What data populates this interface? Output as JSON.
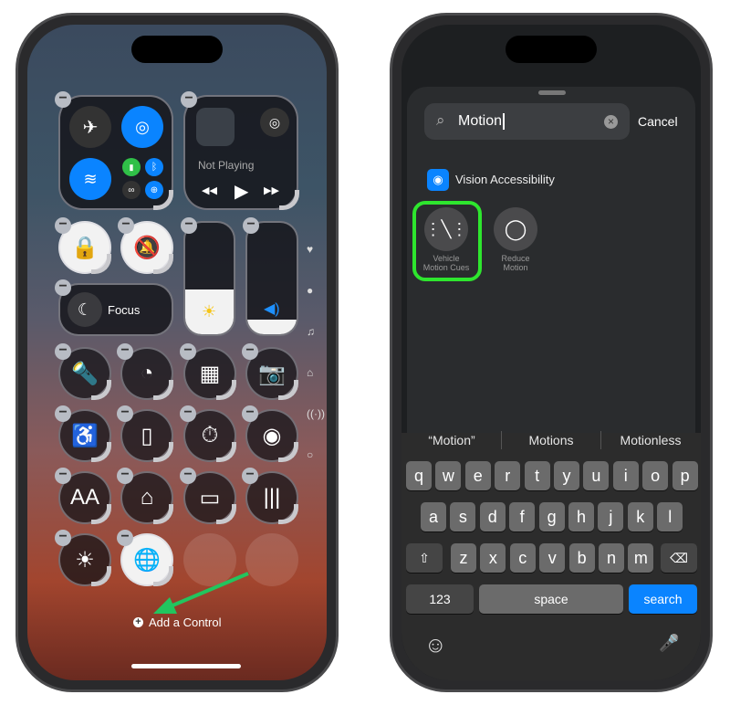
{
  "left": {
    "connectivity": {
      "airplane": "airplane-icon",
      "airdrop": "airdrop-icon",
      "wifi": "wifi-icon",
      "cellular": "cellular-icon",
      "bluetooth": "bluetooth-icon",
      "link": "link-icon",
      "satellite": "satellite-icon"
    },
    "media": {
      "status": "Not Playing",
      "rewind": "◀◀",
      "play": "▶",
      "forward": "▶▶"
    },
    "focus_label": "Focus",
    "brightness_level": 0.4,
    "volume_level": 0.13,
    "controls": [
      {
        "name": "flashlight",
        "glyph": "🔦"
      },
      {
        "name": "timer",
        "glyph": "◔"
      },
      {
        "name": "calculator",
        "glyph": "▦"
      },
      {
        "name": "camera",
        "glyph": "📷"
      },
      {
        "name": "accessibility",
        "glyph": "♿"
      },
      {
        "name": "remote",
        "glyph": "▯"
      },
      {
        "name": "stopwatch",
        "glyph": "⏱"
      },
      {
        "name": "screen-record",
        "glyph": "◉"
      },
      {
        "name": "text-size",
        "glyph": "AA"
      },
      {
        "name": "home",
        "glyph": "⌂"
      },
      {
        "name": "low-power",
        "glyph": "▭"
      },
      {
        "name": "sound-recognition",
        "glyph": "|||"
      },
      {
        "name": "dark-mode",
        "glyph": "☀"
      },
      {
        "name": "satellite",
        "glyph": "🌐"
      },
      {
        "name": "empty",
        "glyph": ""
      },
      {
        "name": "empty",
        "glyph": ""
      }
    ],
    "add_control_label": "Add a Control",
    "side_icons": [
      "♥",
      "●",
      "♫",
      "⌂",
      "((·))",
      "○"
    ],
    "arrow_color": "#22c55e"
  },
  "right": {
    "search": {
      "value": "Motion",
      "clear": "×",
      "cancel": "Cancel"
    },
    "section_title": "Vision Accessibility",
    "results": [
      {
        "label_line1": "Vehicle",
        "label_line2": "Motion Cues",
        "highlight": true
      },
      {
        "label_line1": "Reduce",
        "label_line2": "Motion",
        "highlight": false
      }
    ],
    "highlight_color": "#2ee62e",
    "suggestions": [
      "“Motion”",
      "Motions",
      "Motionless"
    ],
    "keyboard": {
      "rows": [
        [
          "q",
          "w",
          "e",
          "r",
          "t",
          "y",
          "u",
          "i",
          "o",
          "p"
        ],
        [
          "a",
          "s",
          "d",
          "f",
          "g",
          "h",
          "j",
          "k",
          "l"
        ],
        [
          "z",
          "x",
          "c",
          "v",
          "b",
          "n",
          "m"
        ]
      ],
      "shift": "⇧",
      "delete": "⌫",
      "numbers": "123",
      "space": "space",
      "search": "search",
      "emoji": "☺",
      "mic": "🎤"
    }
  }
}
